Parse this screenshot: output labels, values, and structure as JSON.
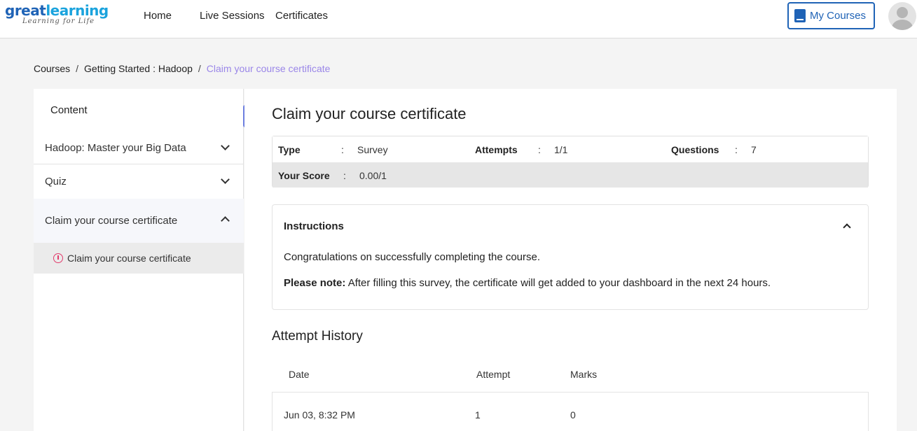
{
  "header": {
    "logo_main_a": "great",
    "logo_main_b": "learning",
    "logo_sub": "Learning for Life",
    "nav": [
      "Home",
      "Live Sessions",
      "Certificates"
    ],
    "my_courses_label": "My Courses"
  },
  "breadcrumb": {
    "items": [
      "Courses",
      "Getting Started : Hadoop",
      "Claim your course certificate"
    ],
    "separator": "/"
  },
  "sidebar": {
    "title": "Content",
    "sections": [
      {
        "label": "Hadoop: Master your Big Data",
        "expanded": false
      },
      {
        "label": "Quiz",
        "expanded": false
      },
      {
        "label": "Claim your course certificate",
        "expanded": true
      }
    ],
    "active_item": "Claim your course certificate"
  },
  "collapse_icon": "«",
  "main": {
    "title": "Claim your course certificate",
    "meta": {
      "type_label": "Type",
      "type_value": "Survey",
      "attempts_label": "Attempts",
      "attempts_value": "1/1",
      "questions_label": "Questions",
      "questions_value": "7",
      "score_label": "Your Score",
      "score_value": "0.00/1",
      "colon": ":"
    },
    "instructions": {
      "heading": "Instructions",
      "line1": "Congratulations on successfully completing the course.",
      "note_label": "Please note:",
      "note_text": " After filling this survey, the certificate will get added to your dashboard in the next 24 hours."
    },
    "history": {
      "title": "Attempt History",
      "columns": [
        "Date",
        "Attempt",
        "Marks"
      ],
      "rows": [
        {
          "date": "Jun 03, 8:32 PM",
          "attempt": "1",
          "marks": "0"
        }
      ]
    }
  },
  "colors": {
    "brand_blue": "#1f63b6",
    "breadcrumb_active": "#9a86e8",
    "collapse_button": "#6d7fe0",
    "pin_icon": "#e23a6b"
  }
}
